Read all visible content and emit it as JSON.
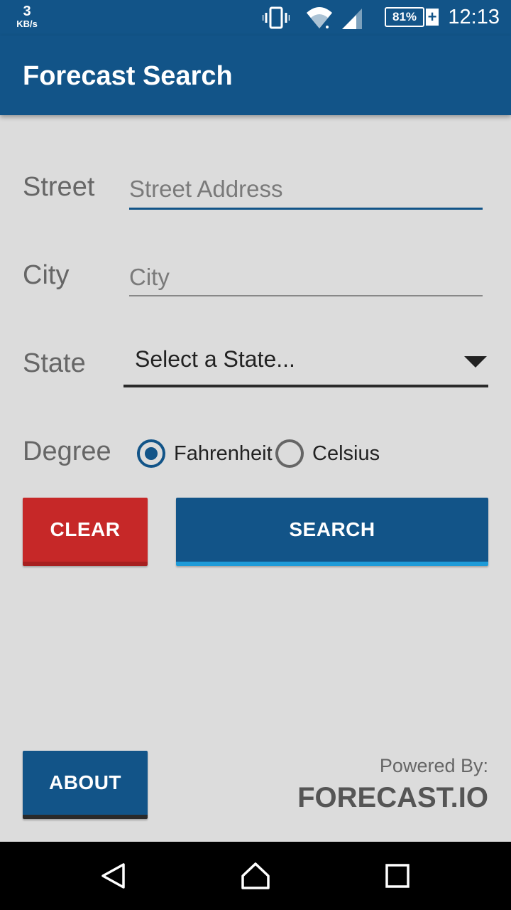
{
  "status_bar": {
    "net_speed_value": "3",
    "net_speed_unit": "KB/s",
    "battery_percent": "81%",
    "battery_charging_symbol": "+",
    "time": "12:13",
    "icons": [
      "vibrate-icon",
      "wifi-icon",
      "signal-icon",
      "battery-icon"
    ]
  },
  "app_bar": {
    "title": "Forecast Search"
  },
  "form": {
    "street": {
      "label": "Street",
      "placeholder": "Street Address",
      "value": ""
    },
    "city": {
      "label": "City",
      "placeholder": "City",
      "value": ""
    },
    "state": {
      "label": "State",
      "selected": "Select a State..."
    },
    "degree": {
      "label": "Degree",
      "options": [
        {
          "label": "Fahrenheit",
          "checked": true
        },
        {
          "label": "Celsius",
          "checked": false
        }
      ]
    }
  },
  "buttons": {
    "clear": "CLEAR",
    "search": "SEARCH",
    "about": "ABOUT"
  },
  "footer": {
    "powered_by": "Powered By:",
    "brand": "FORECAST.IO"
  },
  "nav_bar": {
    "icons": [
      "back-icon",
      "home-icon",
      "recents-icon"
    ]
  },
  "colors": {
    "primary": "#125488",
    "accent": "#1e9bd8",
    "clear_button": "#c62828",
    "background": "#dcdcdc"
  }
}
